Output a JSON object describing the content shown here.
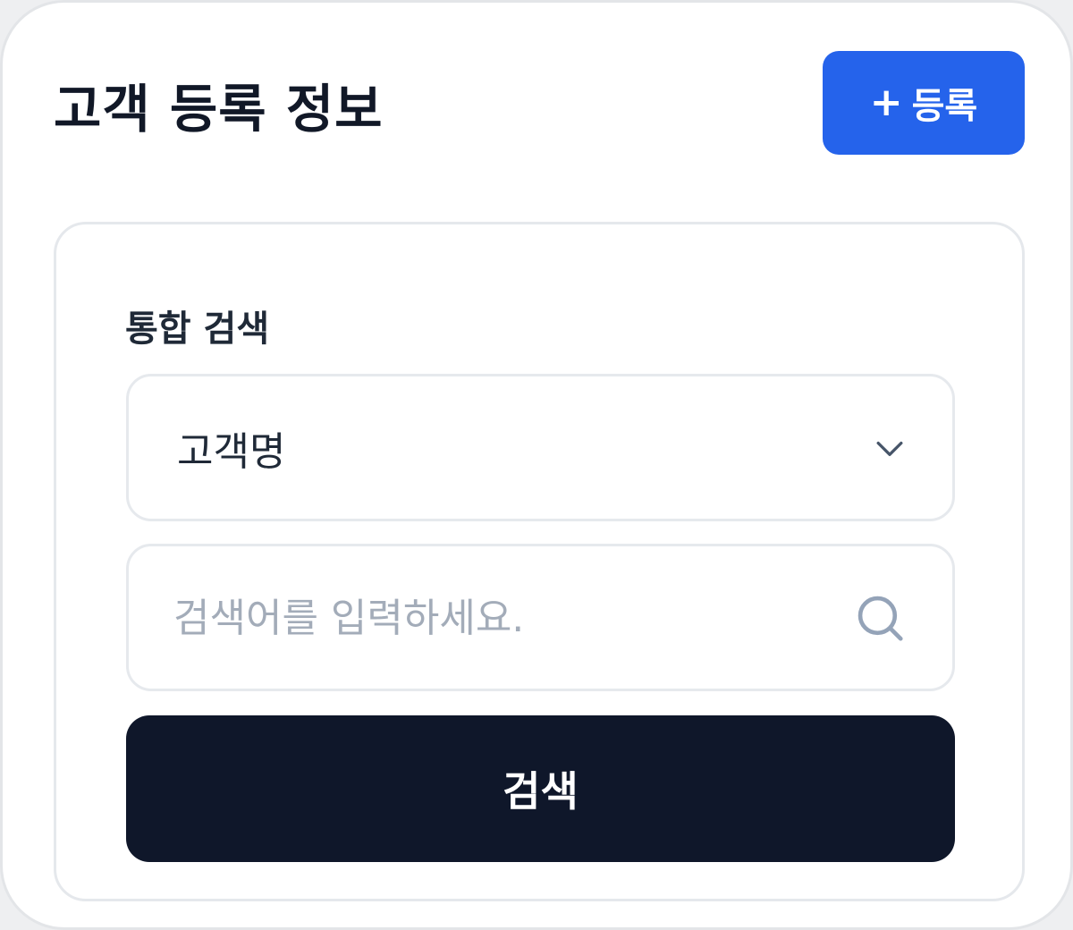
{
  "header": {
    "title": "고객 등록 정보",
    "register_plus": "+",
    "register_label": "등록"
  },
  "search": {
    "section_label": "통합 검색",
    "filter_selected": "고객명",
    "query_value": "",
    "query_placeholder": "검색어를 입력하세요.",
    "submit_label": "검색"
  },
  "icons": {
    "dropdown": "chevron-down-icon",
    "search": "search-icon"
  },
  "colors": {
    "primary": "#2563eb",
    "dark_button": "#0f172a",
    "text": "#111827",
    "placeholder": "#a3acb9",
    "border": "#e6e9ed"
  }
}
